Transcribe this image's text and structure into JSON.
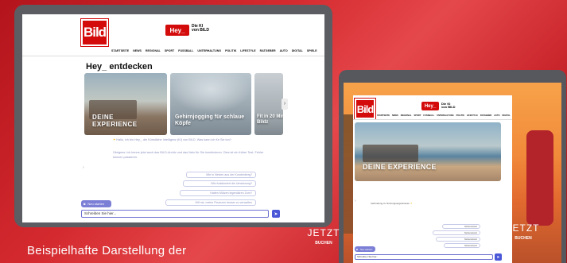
{
  "caption": "Beispielhafte Darstellung der",
  "left": {
    "logo": "Bild",
    "hey": {
      "badge": "Hey_",
      "tagline_1": "Die KI",
      "tagline_2": "von BILD"
    },
    "nav": [
      "STARTSEITE",
      "NEWS",
      "REGIONAL",
      "SPORT",
      "FUSSBALL",
      "UNTERHALTUNG",
      "POLITIK",
      "LIFESTYLE",
      "RATGEBER",
      "AUTO",
      "DIGITAL",
      "SPIELE"
    ],
    "section_title": "Hey_ entdecken",
    "cards": [
      {
        "title": "DEINE EXPERIENCE"
      },
      {
        "title": "Gehirnjogging für schlaue Köpfe"
      },
      {
        "title": "Fit in 20 Min Mit Bildz"
      }
    ],
    "intro_1": "Hallo, ich bin Hey_, die Künstliche Intelligenz (KI) von BILD. Was kann ich für Sie tun?",
    "intro_2": "Übrigens: Ich kenne jetzt auch das BILD-Archiv und das Netz für Sie kombinieren. Dies ist ein früher Test. Fehler können passieren.",
    "suggestions": [
      "Wie in Netzen aus der Kundenberg?",
      "Wie funktioniert die Umsetzung?",
      "Hatten Mützen legendären Zorn?",
      "Hilf mir, meine Finanzen besser zu verwalten"
    ],
    "new_chat": "Neu starten",
    "input_placeholder": "Schreiben Sie hier..."
  },
  "right": {
    "logo": "Bild",
    "hey": {
      "badge": "Hey_",
      "tagline_1": "Die KI",
      "tagline_2": "von BILD"
    },
    "nav": [
      "STARTSEITE",
      "NEWS",
      "REGIONAL",
      "SPORT",
      "FUSSBALL",
      "UNTERHALTUNG",
      "POLITIK",
      "LIFESTYLE",
      "RATGEBER",
      "AUTO",
      "DIGITAL",
      "SPIELE"
    ],
    "hero_title": "DEINE EXPERIENCE",
    "message": "Verbindung zu Nutzungsergebnissen",
    "replies": [
      "Nutzerantwort",
      "Nutzerantwort",
      "Nutzerantwort",
      "Nutzerantwort"
    ],
    "new_chat": "Neu starten",
    "input_placeholder": "Schreiben Sie hier...",
    "ad_left": {
      "line1": "JETZT",
      "line2": "BUCHEN"
    },
    "ad_right": {
      "line1": "JETZT",
      "line2": "BUCHEN"
    }
  },
  "colors": {
    "brand_red": "#d40b0b",
    "accent": "#7c7fd6",
    "bg_red": "#c9262c"
  }
}
